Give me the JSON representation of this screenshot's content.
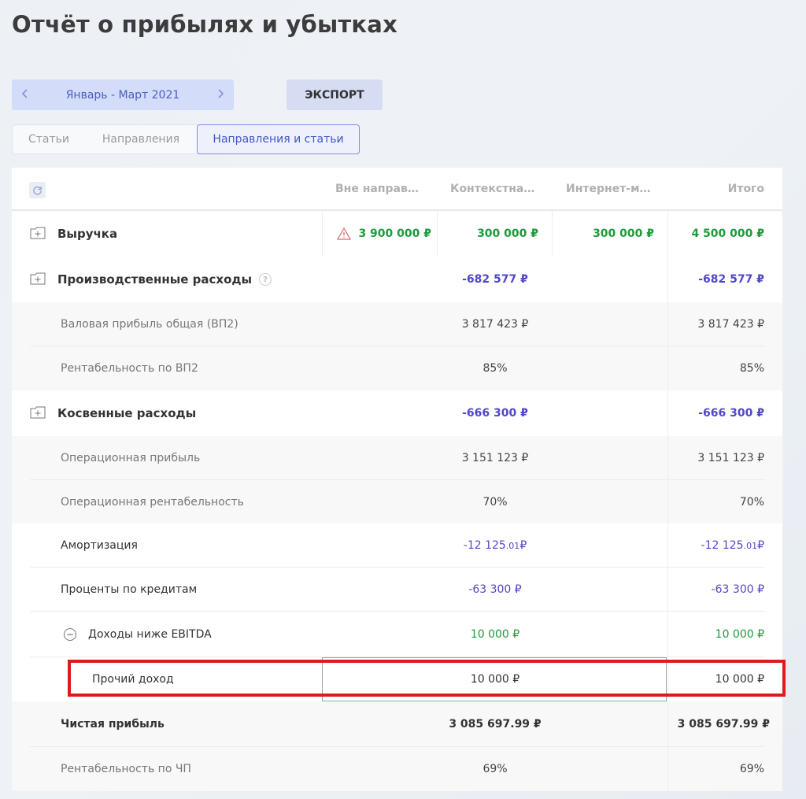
{
  "page": {
    "title": "Отчёт о прибылях и убытках"
  },
  "period": {
    "label": "Январь - Март 2021",
    "prev_icon": "chevron-left-icon",
    "next_icon": "chevron-right-icon"
  },
  "toolbar": {
    "export_label": "ЭКСПОРТ"
  },
  "tabs": [
    {
      "label": "Статьи",
      "active": false
    },
    {
      "label": "Направления",
      "active": false
    },
    {
      "label": "Направления и статьи",
      "active": true
    }
  ],
  "table": {
    "refresh_icon": "refresh-icon",
    "columns": [
      "Вне направ…",
      "Контекстна…",
      "Интернет-м…",
      "Итого"
    ],
    "rows": {
      "revenue": {
        "label": "Выручка",
        "values": [
          "3 900 000 ₽",
          "300 000 ₽",
          "300 000 ₽"
        ],
        "total": "4 500 000 ₽",
        "warning_icon": "warning-icon"
      },
      "production": {
        "label": "Производственные расходы",
        "value": "-682 577 ₽",
        "total": "-682 577 ₽",
        "help_icon": "question-icon"
      },
      "gross_profit": {
        "label": "Валовая прибыль общая (ВП2)",
        "value": "3 817 423 ₽",
        "total": "3 817 423 ₽"
      },
      "gross_margin": {
        "label": "Рентабельность по ВП2",
        "value": "85%",
        "total": "85%"
      },
      "indirect": {
        "label": "Косвенные расходы",
        "value": "-666 300 ₽",
        "total": "-666 300 ₽"
      },
      "op_profit": {
        "label": "Операционная прибыль",
        "value": "3 151 123 ₽",
        "total": "3 151 123 ₽"
      },
      "op_margin": {
        "label": "Операционная рентабельность",
        "value": "70%",
        "total": "70%"
      },
      "amortization": {
        "label": "Амортизация",
        "value_main": "-12 125",
        "value_cents": ".01",
        "value_cur": " ₽",
        "total_main": "-12 125",
        "total_cents": ".01",
        "total_cur": " ₽"
      },
      "interest": {
        "label": "Проценты по кредитам",
        "value": "-63 300 ₽",
        "total": "-63 300 ₽"
      },
      "below_ebitda": {
        "label": "Доходы ниже EBITDA",
        "value": "10 000 ₽",
        "total": "10 000 ₽"
      },
      "other_income": {
        "label": "Прочий доход",
        "value": "10 000 ₽",
        "total": "10 000 ₽"
      },
      "net_profit": {
        "label": "Чистая прибыль",
        "value": "3 085 697.99 ₽",
        "total": "3 085 697.99 ₽"
      },
      "net_margin": {
        "label": "Рентабельность по ЧП",
        "value": "69%",
        "total": "69%"
      }
    }
  },
  "colors": {
    "accent": "#4a5fc1",
    "positive": "#1f9a3a",
    "negative": "#5147c6",
    "highlight": "#de1a1a"
  }
}
